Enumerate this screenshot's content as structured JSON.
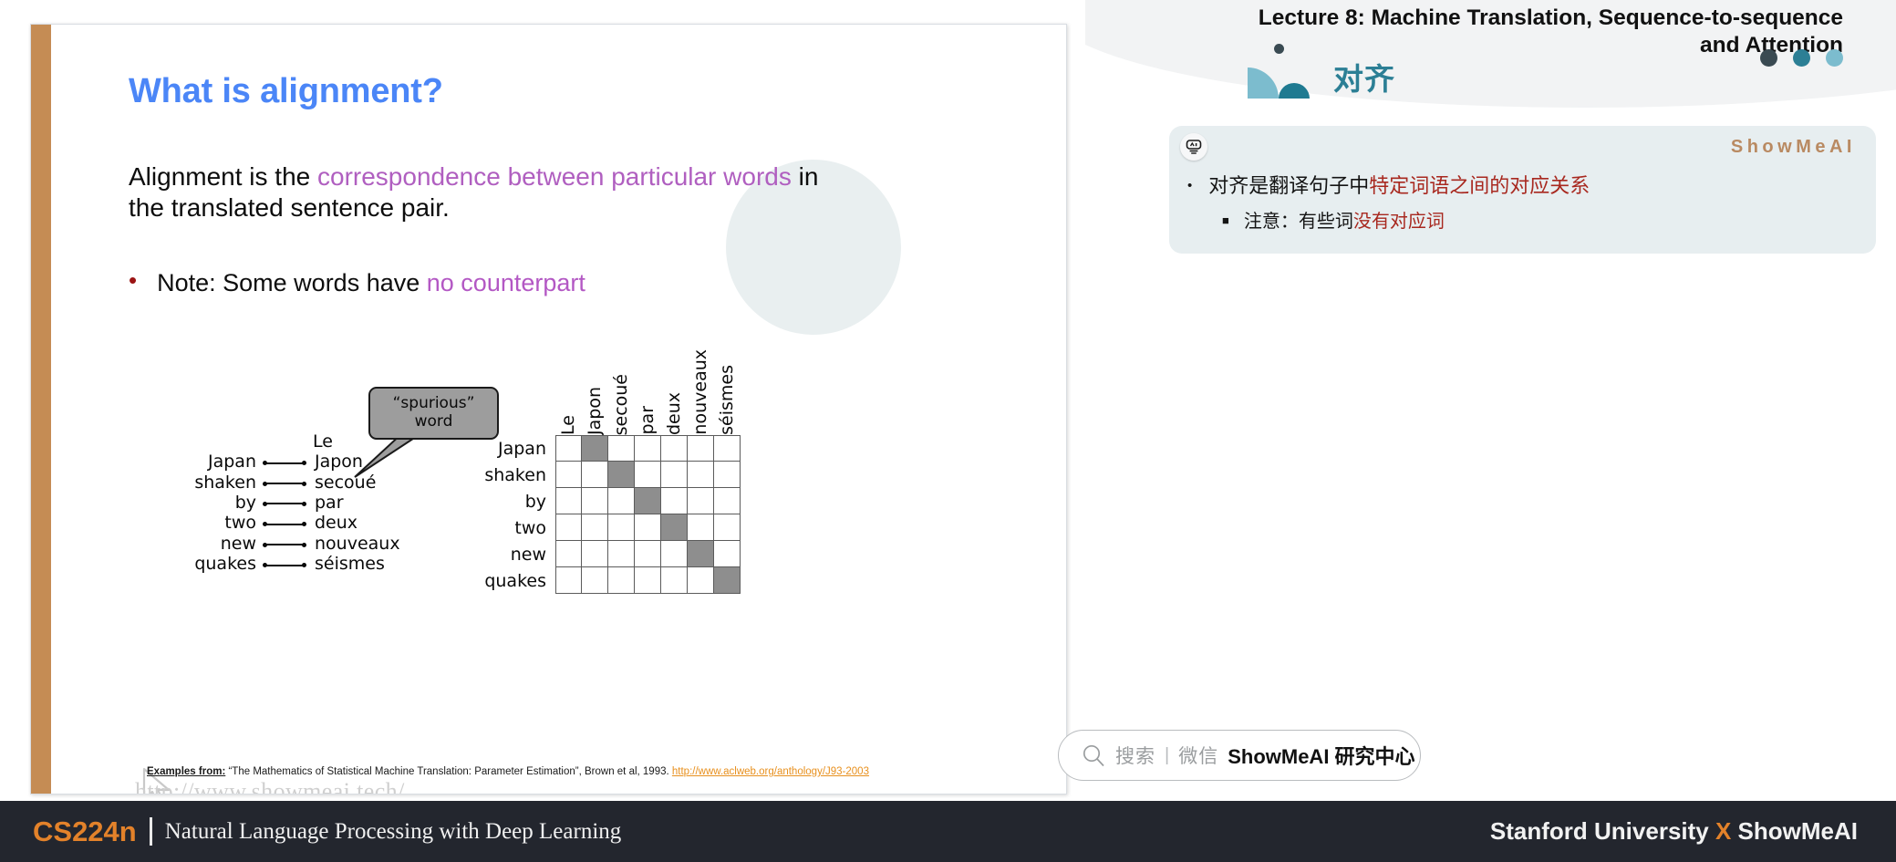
{
  "slide": {
    "title": "What is alignment?",
    "paragraph": {
      "pre": "Alignment is the ",
      "highlight": "correspondence between particular words",
      "post": " in the translated sentence pair."
    },
    "bullet": {
      "marker": "•",
      "pre": "Note: Some words have ",
      "highlight": "no counterpart"
    },
    "figure": {
      "callout_line1": "“spurious”",
      "callout_line2": "word",
      "orphan_target": "Le",
      "pairs": [
        {
          "source": "Japan",
          "target": "Japon"
        },
        {
          "source": "shaken",
          "target": "secoué"
        },
        {
          "source": "by",
          "target": "par"
        },
        {
          "source": "two",
          "target": "deux"
        },
        {
          "source": "new",
          "target": "nouveaux"
        },
        {
          "source": "quakes",
          "target": "séismes"
        }
      ],
      "matrix": {
        "columns": [
          "Le",
          "Japon",
          "secoué",
          "par",
          "deux",
          "nouveaux",
          "séismes"
        ],
        "rows": [
          "Japan",
          "shaken",
          "by",
          "two",
          "new",
          "quakes"
        ],
        "filled": [
          [
            0,
            1,
            0,
            0,
            0,
            0,
            0
          ],
          [
            0,
            0,
            1,
            0,
            0,
            0,
            0
          ],
          [
            0,
            0,
            0,
            1,
            0,
            0,
            0
          ],
          [
            0,
            0,
            0,
            0,
            1,
            0,
            0
          ],
          [
            0,
            0,
            0,
            0,
            0,
            1,
            0
          ],
          [
            0,
            0,
            0,
            0,
            0,
            0,
            1
          ]
        ]
      }
    },
    "footnote": {
      "label": "Examples from:",
      "citation": " “The Mathematics of Statistical Machine Translation: Parameter Estimation”, Brown et al, 1993. ",
      "link": "http://www.aclweb.org/anthology/J93-2003"
    },
    "watermark": "http://www.showmeai.tech/"
  },
  "right_panel": {
    "lecture_title_line1": "Lecture 8:  Machine Translation, Sequence-to-sequence",
    "lecture_title_line2": "and Attention",
    "section_title": "对齐",
    "note_box": {
      "brand": "ShowMeAI",
      "line1": {
        "marker": "•",
        "pre": "对齐是翻译句子中",
        "highlight": "特定词语之间的对应关系"
      },
      "line2": {
        "marker": "■",
        "pre": "注意：有些词",
        "highlight": "没有对应词"
      }
    },
    "searchbar": {
      "placeholder": "搜索",
      "separator": "|",
      "channel": "微信",
      "account": "ShowMeAI 研究中心"
    }
  },
  "bottom_bar": {
    "course_code": "CS224n",
    "course_name": "Natural Language Processing with Deep Learning",
    "affiliation_pre": "Stanford University ",
    "affiliation_x": "X",
    "affiliation_post": " ShowMeAI"
  },
  "colors": {
    "accent_orange": "#e3822a",
    "title_blue": "#4b86f7",
    "highlight_purple": "#b05fc0",
    "teal": "#2c7f95",
    "note_bg": "#e7eef0",
    "highlight_red": "#a8281f",
    "slide_bar": "#c58c54",
    "bottom_bar": "#23262e"
  }
}
